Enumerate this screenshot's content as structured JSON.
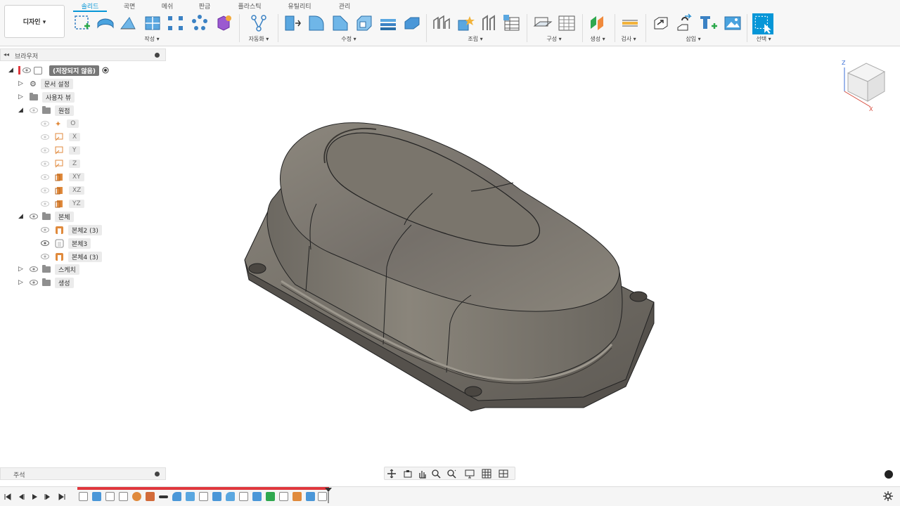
{
  "workspace": {
    "label": "디자인 ▾"
  },
  "tabs": [
    {
      "label": "솔리드",
      "active": true
    },
    {
      "label": "곡면",
      "active": false
    },
    {
      "label": "메쉬",
      "active": false
    },
    {
      "label": "판금",
      "active": false
    },
    {
      "label": "플라스틱",
      "active": false
    },
    {
      "label": "유틸리티",
      "active": false
    },
    {
      "label": "관리",
      "active": false
    }
  ],
  "groups": {
    "create": "작성 ▾",
    "automate": "자동화 ▾",
    "modify": "수정 ▾",
    "assemble": "조립 ▾",
    "construct": "구성 ▾",
    "generate": "생성 ▾",
    "inspect": "검사 ▾",
    "insert": "삽입 ▾",
    "select": "선택 ▾"
  },
  "browser": {
    "title": "브라우저",
    "collapse": "◂◂",
    "root": "(저장되지 않음)",
    "items": {
      "doc_settings": "문서 설정",
      "named_views": "사용자 뷰",
      "origin": "원점",
      "origin_o": "O",
      "origin_x": "X",
      "origin_y": "Y",
      "origin_z": "Z",
      "origin_xy": "XY",
      "origin_xz": "XZ",
      "origin_yz": "YZ",
      "bodies": "본체",
      "body2": "본체2 (3)",
      "body3": "본체3",
      "body4": "본체4 (3)",
      "sketches": "스케치",
      "construction": "생성"
    }
  },
  "notes": {
    "title": "주석"
  },
  "viewcube": {
    "z": "Z",
    "x": "X"
  },
  "colors": {
    "accent": "#0696d7",
    "timeline": "#e0373d",
    "origin_orange": "#e08a3c",
    "model": "#7d786f"
  }
}
